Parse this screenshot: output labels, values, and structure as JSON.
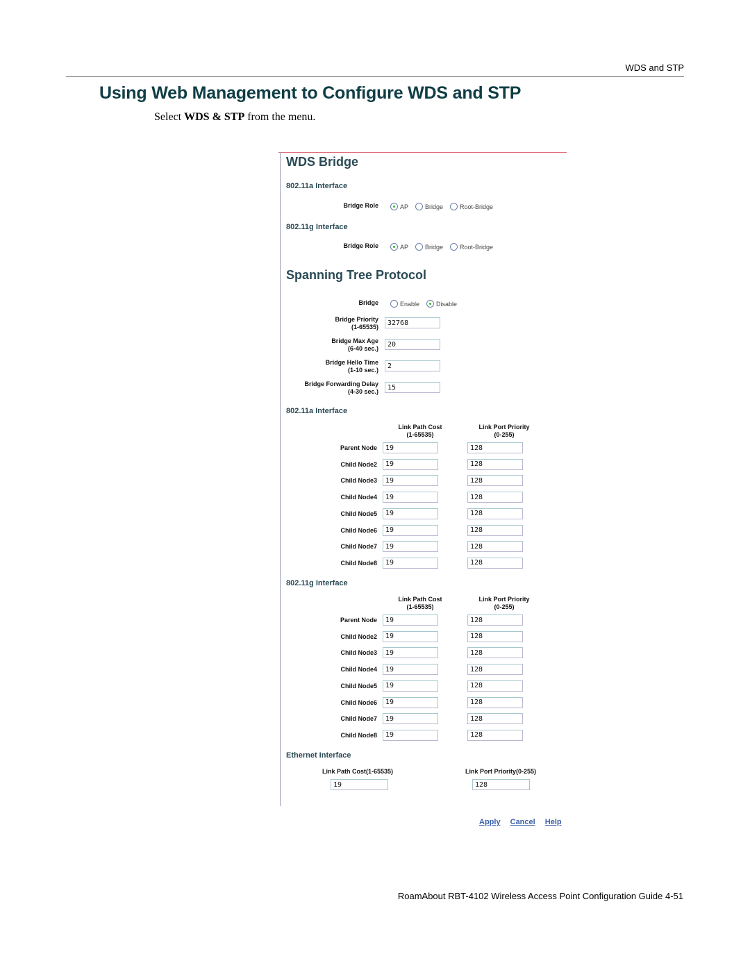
{
  "page": {
    "running_head": "WDS and STP",
    "title": "Using Web Management to Configure WDS and STP",
    "instruction": {
      "prefix": "Select ",
      "bold1": "WDS",
      "amp": " & ",
      "bold2": "STP",
      "suffix": " from the menu."
    },
    "footer": "RoamAbout RBT-4102 Wireless Access Point Configuration Guide    4-51"
  },
  "wds": {
    "title": "WDS Bridge",
    "interfaces": [
      {
        "name": "802.11a Interface",
        "role_label": "Bridge Role",
        "options": [
          "AP",
          "Bridge",
          "Root-Bridge"
        ],
        "selected": "AP"
      },
      {
        "name": "802.11g Interface",
        "role_label": "Bridge Role",
        "options": [
          "AP",
          "Bridge",
          "Root-Bridge"
        ],
        "selected": "AP"
      }
    ]
  },
  "stp": {
    "title": "Spanning Tree Protocol",
    "bridge": {
      "label": "Bridge",
      "options": [
        "Enable",
        "Disable"
      ],
      "selected": "Disable"
    },
    "fields": [
      {
        "label": "Bridge Priority",
        "range": "(1-65535)",
        "value": "32768"
      },
      {
        "label": "Bridge Max Age",
        "range": "(6-40 sec.)",
        "value": "20"
      },
      {
        "label": "Bridge Hello Time",
        "range": "(1-10 sec.)",
        "value": "2"
      },
      {
        "label": "Bridge Forwarding Delay",
        "range": "(4-30 sec.)",
        "value": "15"
      }
    ],
    "col_cost": "Link Path Cost",
    "col_cost_range": "(1-65535)",
    "col_priority": "Link Port Priority",
    "col_priority_range": "(0-255)",
    "link_interfaces": [
      {
        "name": "802.11a Interface",
        "nodes": [
          {
            "label": "Parent Node",
            "cost": "19",
            "priority": "128"
          },
          {
            "label": "Child Node2",
            "cost": "19",
            "priority": "128"
          },
          {
            "label": "Child Node3",
            "cost": "19",
            "priority": "128"
          },
          {
            "label": "Child Node4",
            "cost": "19",
            "priority": "128"
          },
          {
            "label": "Child Node5",
            "cost": "19",
            "priority": "128"
          },
          {
            "label": "Child Node6",
            "cost": "19",
            "priority": "128"
          },
          {
            "label": "Child Node7",
            "cost": "19",
            "priority": "128"
          },
          {
            "label": "Child Node8",
            "cost": "19",
            "priority": "128"
          }
        ]
      },
      {
        "name": "802.11g Interface",
        "nodes": [
          {
            "label": "Parent Node",
            "cost": "19",
            "priority": "128"
          },
          {
            "label": "Child Node2",
            "cost": "19",
            "priority": "128"
          },
          {
            "label": "Child Node3",
            "cost": "19",
            "priority": "128"
          },
          {
            "label": "Child Node4",
            "cost": "19",
            "priority": "128"
          },
          {
            "label": "Child Node5",
            "cost": "19",
            "priority": "128"
          },
          {
            "label": "Child Node6",
            "cost": "19",
            "priority": "128"
          },
          {
            "label": "Child Node7",
            "cost": "19",
            "priority": "128"
          },
          {
            "label": "Child Node8",
            "cost": "19",
            "priority": "128"
          }
        ]
      }
    ],
    "ethernet": {
      "name": "Ethernet Interface",
      "cost_label": "Link Path Cost(1-65535)",
      "priority_label": "Link Port Priority(0-255)",
      "cost": "19",
      "priority": "128"
    }
  },
  "actions": {
    "apply": "Apply",
    "cancel": "Cancel",
    "help": "Help"
  },
  "colors": {
    "title": "#0f3d45",
    "section_heading": "#2a4a55",
    "link": "#3a5fa8",
    "radio_selected": "#2fb52f",
    "panel_top_rule": "#e06a7a"
  }
}
